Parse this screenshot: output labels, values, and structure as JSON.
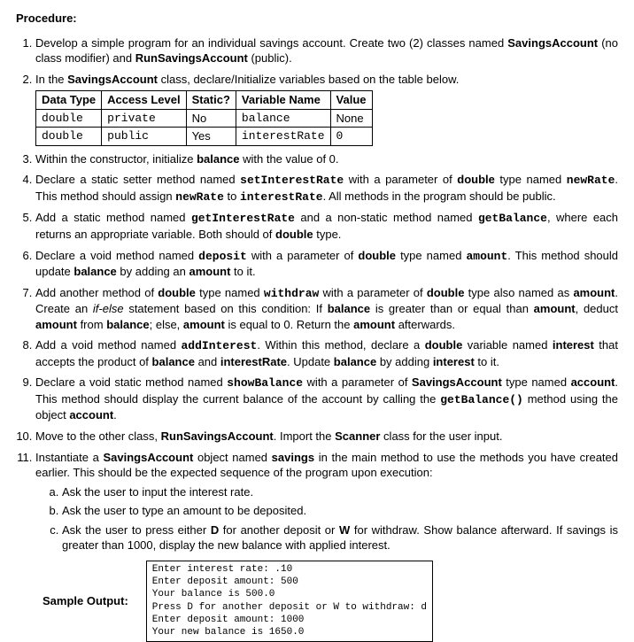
{
  "heading": "Procedure:",
  "items": {
    "i1a": "Develop a simple program for an individual savings account. Create two (2) classes named ",
    "i1b": "SavingsAccount",
    "i1c": " (no class modifier) and ",
    "i1d": "RunSavingsAccount",
    "i1e": " (public).",
    "i2a": "In the ",
    "i2b": "SavingsAccount",
    "i2c": " class, declare/Initialize variables based on the table below.",
    "i3a": "Within the constructor, initialize ",
    "i3b": "balance",
    "i3c": " with the value of 0.",
    "i4a": "Declare a static setter method named ",
    "i4b": "setInterestRate",
    "i4c": " with a parameter of ",
    "i4d": "double",
    "i4e": " type named ",
    "i4f": "newRate",
    "i4g": ". This method should assign ",
    "i4h": "newRate",
    "i4i": " to ",
    "i4j": "interestRate",
    "i4k": ". All methods in the program should be public.",
    "i5a": "Add a static method named ",
    "i5b": "getInterestRate",
    "i5c": " and a non-static method named ",
    "i5d": "getBalance",
    "i5e": ", where each returns an appropriate variable. Both should of ",
    "i5f": "double",
    "i5g": " type.",
    "i6a": "Declare a void method named ",
    "i6b": "deposit",
    "i6c": " with a parameter of ",
    "i6d": "double",
    "i6e": " type named ",
    "i6f": "amount",
    "i6g": ". This method should update ",
    "i6h": "balance",
    "i6i": " by adding an ",
    "i6j": "amount",
    "i6k": " to it.",
    "i7a": "Add another method of ",
    "i7b": "double",
    "i7c": " type named ",
    "i7d": "withdraw",
    "i7e": " with a parameter of ",
    "i7f": "double",
    "i7g": " type also named as ",
    "i7h": "amount",
    "i7i": ". Create an ",
    "i7j": "if-else",
    "i7k": " statement based on this condition: If ",
    "i7l": "balance",
    "i7m": " is greater than or equal than ",
    "i7n": "amount",
    "i7o": ", deduct ",
    "i7p": "amount",
    "i7q": " from ",
    "i7r": "balance",
    "i7s": "; else, ",
    "i7t": "amount",
    "i7u": " is equal to 0. Return the ",
    "i7v": "amount",
    "i7w": " afterwards.",
    "i8a": "Add a void method named ",
    "i8b": "addInterest",
    "i8c": ". Within this method, declare a ",
    "i8d": "double",
    "i8e": " variable named ",
    "i8f": "interest",
    "i8g": " that accepts the product of ",
    "i8h": "balance",
    "i8i": " and ",
    "i8j": "interestRate",
    "i8k": ". Update ",
    "i8l": "balance",
    "i8m": " by adding ",
    "i8n": "interest",
    "i8o": " to it.",
    "i9a": "Declare a void static method named ",
    "i9b": "showBalance",
    "i9c": " with a parameter of ",
    "i9d": "SavingsAccount",
    "i9e": " type named ",
    "i9f": "account",
    "i9g": ". This method should display the current balance of the account by calling the ",
    "i9h": "getBalance()",
    "i9i": " method using the object ",
    "i9j": "account",
    "i9k": ".",
    "i10a": "Move to the other class, ",
    "i10b": "RunSavingsAccount",
    "i10c": ". Import the ",
    "i10d": "Scanner",
    "i10e": " class for the user input.",
    "i11a": "Instantiate a ",
    "i11b": "SavingsAccount",
    "i11c": " object named ",
    "i11d": "savings",
    "i11e": " in the main method to use the methods you have created earlier. This should be the expected sequence of the program upon execution:"
  },
  "sub": {
    "a": "Ask the user to input the interest rate.",
    "b": "Ask the user to type an amount to be deposited.",
    "c1": "Ask the user to press either ",
    "c2": "D",
    "c3": " for another deposit or ",
    "c4": "W",
    "c5": " for withdraw. Show balance afterward. If savings is greater than 1000, display the new balance with applied interest."
  },
  "table": {
    "h1": "Data Type",
    "h2": "Access Level",
    "h3": "Static?",
    "h4": "Variable Name",
    "h5": "Value",
    "r1c1": "double",
    "r1c2": "private",
    "r1c3": "No",
    "r1c4": "balance",
    "r1c5": "None",
    "r2c1": "double",
    "r2c2": "public",
    "r2c3": "Yes",
    "r2c4": "interestRate",
    "r2c5": "0"
  },
  "sample": {
    "label": "Sample Output:",
    "line1": "Enter interest rate: .10",
    "line2": "Enter deposit amount: 500",
    "line3": "Your balance is 500.0",
    "line4": "Press D for another deposit or W to withdraw: d",
    "line5": "Enter deposit amount: 1000",
    "line6": "Your new balance is 1650.0"
  }
}
